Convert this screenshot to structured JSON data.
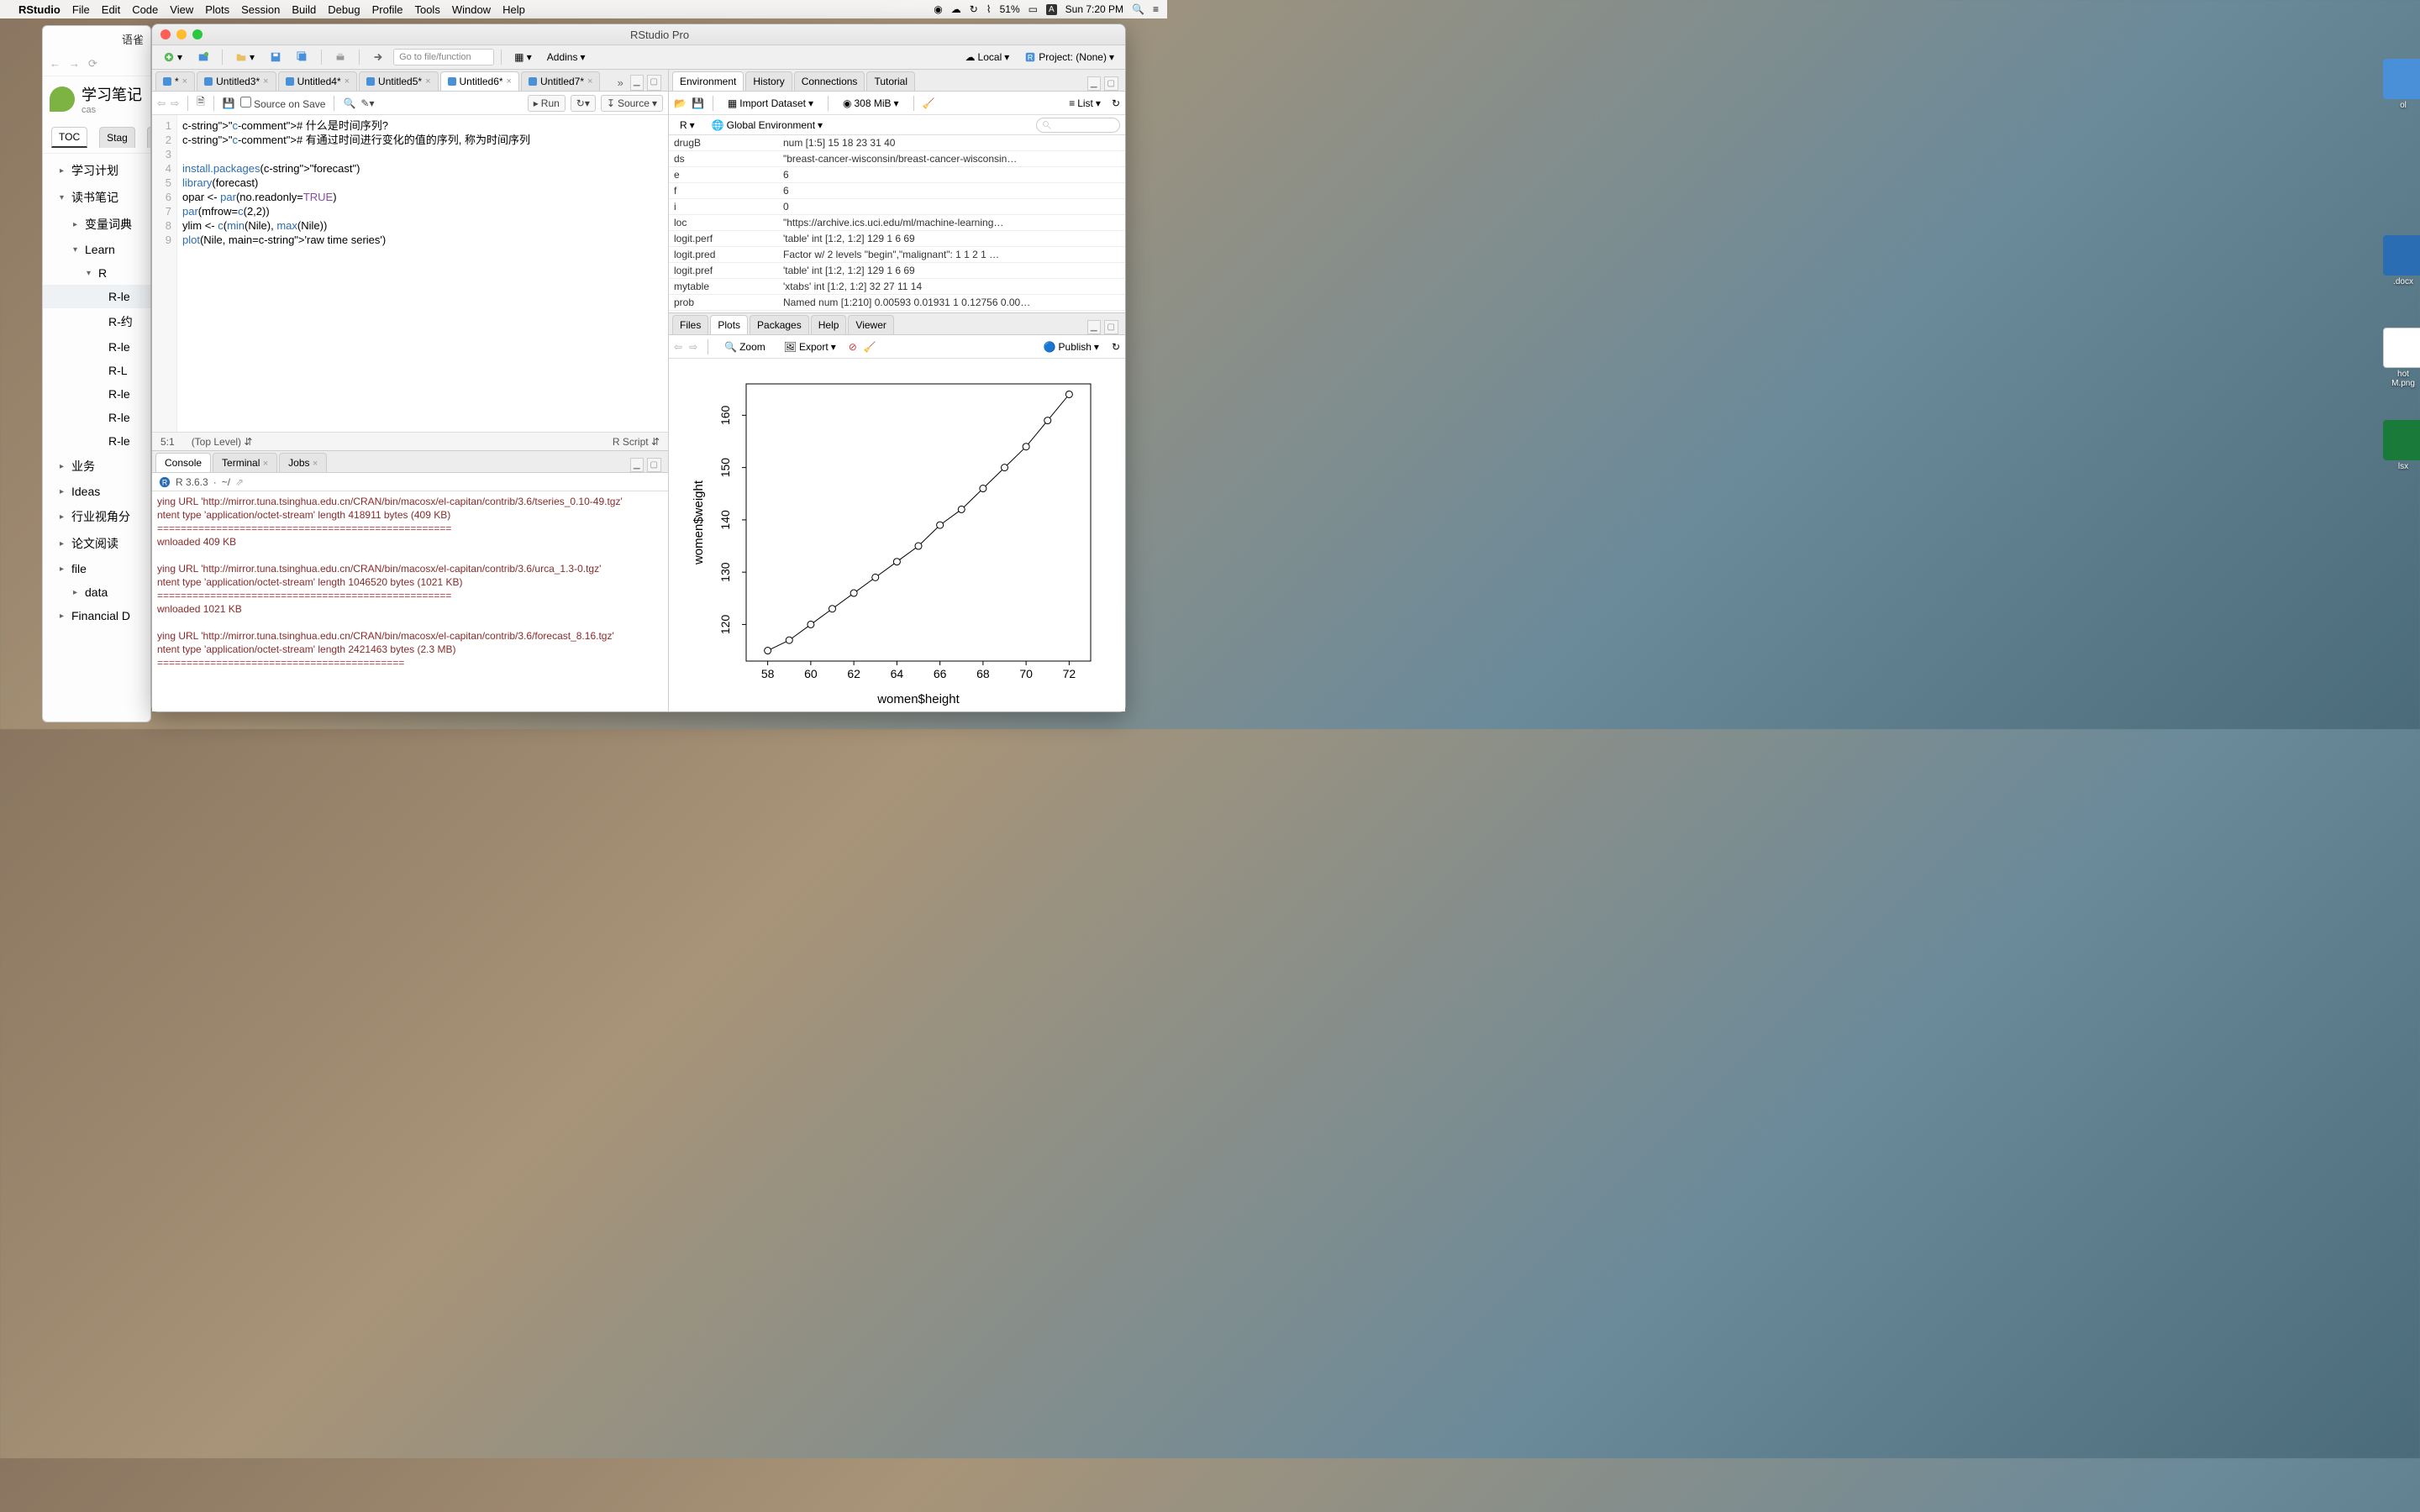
{
  "menubar": {
    "app": "RStudio",
    "items": [
      "File",
      "Edit",
      "Code",
      "View",
      "Plots",
      "Session",
      "Build",
      "Debug",
      "Profile",
      "Tools",
      "Window",
      "Help"
    ],
    "battery": "51%",
    "clock": "Sun 7:20 PM"
  },
  "notes": {
    "winTitle": "语雀",
    "title": "学习笔记",
    "subtitle": "cas",
    "tabs": [
      "TOC",
      "Stag"
    ],
    "more": "···",
    "items": [
      {
        "label": "学习计划",
        "lvl": 1
      },
      {
        "label": "读书笔记",
        "lvl": 1,
        "open": true
      },
      {
        "label": "变量词典",
        "lvl": 2
      },
      {
        "label": "Learn",
        "lvl": 2,
        "open": true
      },
      {
        "label": "R",
        "lvl": 3,
        "open": true
      },
      {
        "label": "R-le",
        "lvl": 4,
        "sel": true
      },
      {
        "label": "R-约",
        "lvl": 4
      },
      {
        "label": "R-le",
        "lvl": 4
      },
      {
        "label": "R-L",
        "lvl": 4
      },
      {
        "label": "R-le",
        "lvl": 4
      },
      {
        "label": "R-le",
        "lvl": 4
      },
      {
        "label": "R-le",
        "lvl": 4
      },
      {
        "label": "业务",
        "lvl": 1
      },
      {
        "label": "Ideas",
        "lvl": 1
      },
      {
        "label": "行业视角分",
        "lvl": 1
      },
      {
        "label": "论文阅读",
        "lvl": 1
      },
      {
        "label": "file",
        "lvl": 1
      },
      {
        "label": "data",
        "lvl": 2
      },
      {
        "label": "Financial D",
        "lvl": 1
      }
    ]
  },
  "rstudio": {
    "title": "RStudio Pro",
    "gotofile": "Go to file/function",
    "addins": "Addins",
    "local": "Local",
    "project": "Project: (None)"
  },
  "source": {
    "tabs": [
      "*",
      "Untitled3*",
      "Untitled4*",
      "Untitled5*",
      "Untitled6*",
      "Untitled7*"
    ],
    "sourceOnSave": "Source on Save",
    "run": "Run",
    "sourceBtn": "Source",
    "lines": [
      "# 什么是时间序列?",
      "# 有通过时间进行变化的值的序列, 称为时间序列",
      "",
      "install.packages(\"forecast\")",
      "library(forecast)",
      "opar <- par(no.readonly=TRUE)",
      "par(mfrow=c(2,2))",
      "ylim <- c(min(Nile), max(Nile))",
      "plot(Nile, main='raw time series')"
    ],
    "pos": "5:1",
    "scope": "(Top Level)",
    "type": "R Script"
  },
  "console": {
    "tabs": [
      "Console",
      "Terminal",
      "Jobs"
    ],
    "version": "R 3.6.3",
    "wd": "~/",
    "lines": [
      {
        "t": "ying URL 'http://mirror.tuna.tsinghua.edu.cn/CRAN/bin/macosx/el-capitan/contrib/3.6/tseries_0.10-49.tgz'",
        "c": "msg"
      },
      {
        "t": "ntent type 'application/octet-stream' length 418911 bytes (409 KB)",
        "c": "msg"
      },
      {
        "t": "==================================================",
        "c": "bar"
      },
      {
        "t": "wnloaded 409 KB",
        "c": "msg"
      },
      {
        "t": "",
        "c": ""
      },
      {
        "t": "ying URL 'http://mirror.tuna.tsinghua.edu.cn/CRAN/bin/macosx/el-capitan/contrib/3.6/urca_1.3-0.tgz'",
        "c": "msg"
      },
      {
        "t": "ntent type 'application/octet-stream' length 1046520 bytes (1021 KB)",
        "c": "msg"
      },
      {
        "t": "==================================================",
        "c": "bar"
      },
      {
        "t": "wnloaded 1021 KB",
        "c": "msg"
      },
      {
        "t": "",
        "c": ""
      },
      {
        "t": "ying URL 'http://mirror.tuna.tsinghua.edu.cn/CRAN/bin/macosx/el-capitan/contrib/3.6/forecast_8.16.tgz'",
        "c": "msg"
      },
      {
        "t": "ntent type 'application/octet-stream' length 2421463 bytes (2.3 MB)",
        "c": "msg"
      },
      {
        "t": "==========================================",
        "c": "bar"
      }
    ]
  },
  "env": {
    "tabs": [
      "Environment",
      "History",
      "Connections",
      "Tutorial"
    ],
    "import": "Import Dataset",
    "mem": "308 MiB",
    "view": "List",
    "lang": "R",
    "scope": "Global Environment",
    "rows": [
      {
        "n": "drugB",
        "v": "num [1:5] 15 18 23 31 40"
      },
      {
        "n": "ds",
        "v": "\"breast-cancer-wisconsin/breast-cancer-wisconsin…"
      },
      {
        "n": "e",
        "v": "6"
      },
      {
        "n": "f",
        "v": "6"
      },
      {
        "n": "i",
        "v": "0"
      },
      {
        "n": "loc",
        "v": "\"https://archive.ics.uci.edu/ml/machine-learning…"
      },
      {
        "n": "logit.perf",
        "v": "'table' int [1:2, 1:2] 129 1 6 69"
      },
      {
        "n": "logit.pred",
        "v": "Factor w/ 2 levels \"begin\",\"malignant\": 1 1 2 1 …"
      },
      {
        "n": "logit.pref",
        "v": "'table' int [1:2, 1:2] 129 1 6 69"
      },
      {
        "n": "mytable",
        "v": "'xtabs' int [1:2, 1:2] 32 27 11 14"
      },
      {
        "n": "prob",
        "v": "Named num [1:210] 0.00593 0.01931 1 0.12756 0.00…"
      }
    ]
  },
  "plots": {
    "tabs": [
      "Files",
      "Plots",
      "Packages",
      "Help",
      "Viewer"
    ],
    "zoom": "Zoom",
    "export": "Export",
    "publish": "Publish"
  },
  "chart_data": {
    "type": "line",
    "x": [
      58,
      59,
      60,
      61,
      62,
      63,
      64,
      65,
      66,
      67,
      68,
      69,
      70,
      71,
      72
    ],
    "y": [
      115,
      117,
      120,
      123,
      126,
      129,
      132,
      135,
      139,
      142,
      146,
      150,
      154,
      159,
      164
    ],
    "xlabel": "women$height",
    "ylabel": "women$weight",
    "xticks": [
      58,
      60,
      62,
      64,
      66,
      68,
      70,
      72
    ],
    "yticks": [
      120,
      130,
      140,
      150,
      160
    ],
    "xlim": [
      57,
      73
    ],
    "ylim": [
      113,
      166
    ]
  },
  "desktop": {
    "items": [
      "ol",
      ".docx",
      "hot\nM.png",
      "lsx"
    ]
  }
}
